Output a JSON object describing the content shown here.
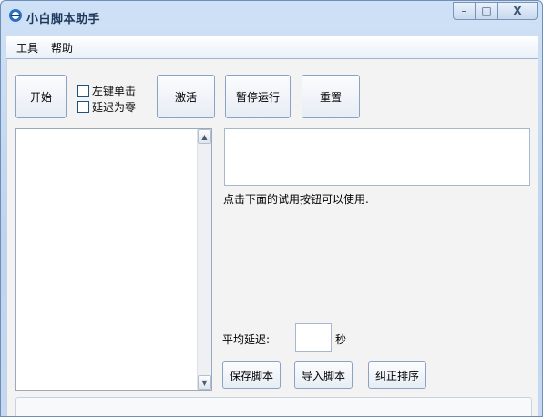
{
  "window": {
    "title": "小白脚本助手",
    "caption_buttons": {
      "minimize": "–",
      "maximize": "□",
      "close": "X"
    }
  },
  "menu": {
    "items": [
      "工具",
      "帮助"
    ]
  },
  "toolbar": {
    "start": "开始",
    "activate": "激活",
    "pause": "暂停运行",
    "reset": "重置",
    "checks": [
      {
        "label": "左键单击",
        "checked": false
      },
      {
        "label": "延迟为零",
        "checked": false
      }
    ]
  },
  "main": {
    "hint": "点击下面的试用按钮可以使用.",
    "delay_label": "平均延迟:",
    "delay_value": "",
    "delay_unit": "秒",
    "buttons": {
      "save": "保存脚本",
      "import": "导入脚本",
      "sort": "纠正排序"
    }
  },
  "icons": {
    "app": "app-icon",
    "scroll_up": "triangle-up-icon",
    "scroll_down": "triangle-down-icon"
  }
}
